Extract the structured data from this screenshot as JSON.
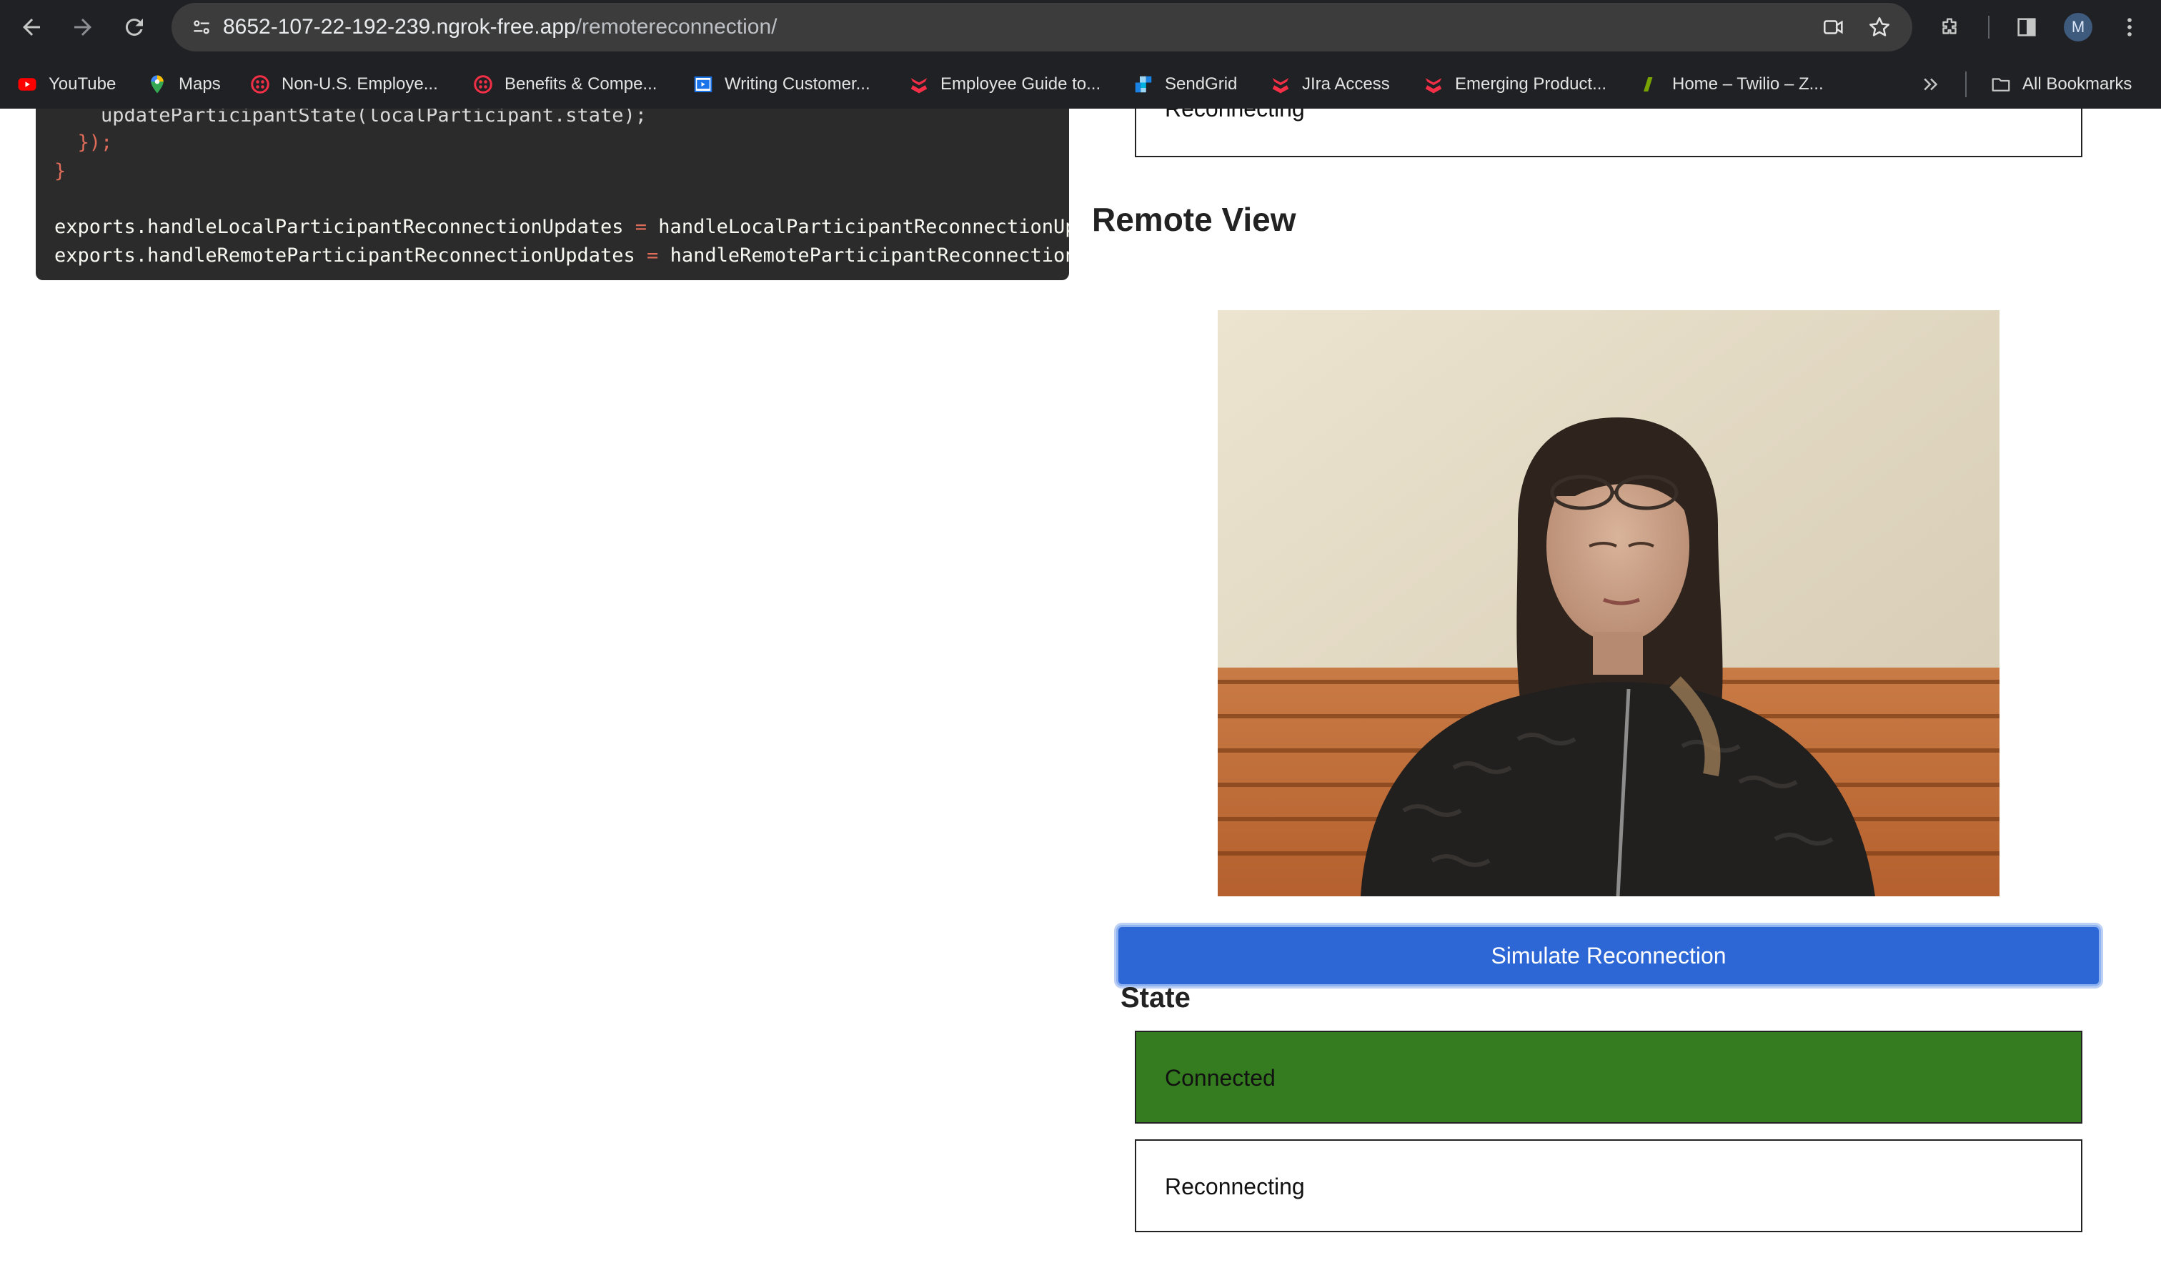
{
  "browser": {
    "url_host": "8652-107-22-192-239.ngrok-free.app",
    "url_path": "/remotereconnection/",
    "profile_initial": "M",
    "bookmarks": [
      {
        "label": "YouTube",
        "icon": "youtube-icon",
        "color": "#ff0000"
      },
      {
        "label": "Maps",
        "icon": "maps-icon",
        "color": "#34a853"
      },
      {
        "label": "Non-U.S. Employe...",
        "icon": "twilio-icon",
        "color": "#f22f46"
      },
      {
        "label": "Benefits & Compe...",
        "icon": "twilio-icon",
        "color": "#f22f46"
      },
      {
        "label": "Writing Customer...",
        "icon": "video-doc-icon",
        "color": "#1a73e8"
      },
      {
        "label": "Employee Guide to...",
        "icon": "segment-icon",
        "color": "#f22f46"
      },
      {
        "label": "SendGrid",
        "icon": "sendgrid-icon",
        "color": "#1a82e2"
      },
      {
        "label": "JIra Access",
        "icon": "segment-icon",
        "color": "#f22f46"
      },
      {
        "label": "Emerging Product...",
        "icon": "segment-icon",
        "color": "#f22f46"
      },
      {
        "label": "Home – Twilio – Z...",
        "icon": "zendesk-icon",
        "color": "#78a300"
      }
    ],
    "all_bookmarks_label": "All Bookmarks"
  },
  "code": {
    "line1": "    updateParticipantState(localParticipant.state);",
    "line2": "  });",
    "line3": "}",
    "line4_a": "exports",
    "line4_b": ".handleLocalParticipantReconnectionUpdates ",
    "line4_c": "=",
    "line4_d": " handleLocalParticipantReconnectionUpdat",
    "line5_a": "exports",
    "line5_b": ".handleRemoteParticipantReconnectionUpdates ",
    "line5_c": "=",
    "line5_d": " handleRemoteParticipantReconnectionUpd"
  },
  "main": {
    "top_state_label": "Reconnecting",
    "remote_view_title": "Remote View",
    "simulate_button": "Simulate Reconnection",
    "state_title": "State",
    "states": [
      {
        "label": "Connected",
        "color": "#357c20"
      },
      {
        "label": "Reconnecting",
        "color": "#ffffff"
      }
    ]
  }
}
